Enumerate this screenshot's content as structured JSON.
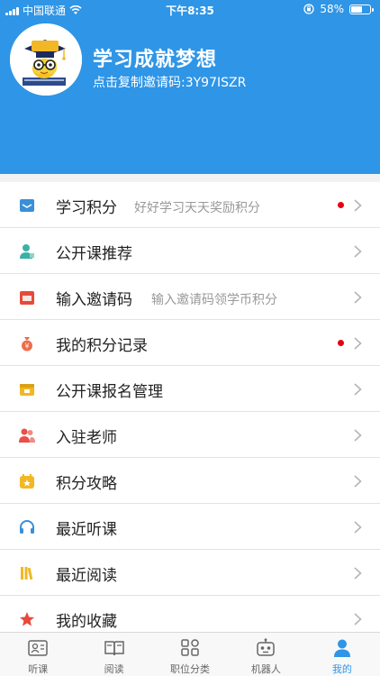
{
  "status_bar": {
    "carrier": "中国联通",
    "time": "下午8:35",
    "battery": "58%",
    "battery_level": 0.58
  },
  "profile": {
    "title": "学习成就梦想",
    "invite_text": "点击复制邀请码:3Y97ISZR",
    "avatar_badge": "学霸"
  },
  "menu": [
    {
      "label": "学习积分",
      "sub": "好好学习天天奖励积分",
      "dot": true,
      "icon": "envelope-icon",
      "color": "#3a8fd8"
    },
    {
      "label": "公开课推荐",
      "sub": "",
      "dot": false,
      "icon": "user-teacher-icon",
      "color": "#3bb1a8"
    },
    {
      "label": "输入邀请码",
      "sub": "输入邀请码领学币积分",
      "dot": false,
      "icon": "calendar-icon",
      "color": "#e64a3b"
    },
    {
      "label": "我的积分记录",
      "sub": "",
      "dot": true,
      "icon": "money-bag-icon",
      "color": "#ef6b4a"
    },
    {
      "label": "公开课报名管理",
      "sub": "",
      "dot": false,
      "icon": "signup-box-icon",
      "color": "#f2b724"
    },
    {
      "label": "入驻老师",
      "sub": "",
      "dot": false,
      "icon": "users-icon",
      "color": "#e8504a"
    },
    {
      "label": "积分攻略",
      "sub": "",
      "dot": false,
      "icon": "star-box-icon",
      "color": "#f2b724"
    },
    {
      "label": "最近听课",
      "sub": "",
      "dot": false,
      "icon": "headphones-icon",
      "color": "#3a8fd8"
    },
    {
      "label": "最近阅读",
      "sub": "",
      "dot": false,
      "icon": "books-icon",
      "color": "#f2b724"
    },
    {
      "label": "我的收藏",
      "sub": "",
      "dot": false,
      "icon": "star-icon",
      "color": "#e64a3b"
    }
  ],
  "tabs": [
    {
      "label": "听课",
      "icon": "id-card-icon",
      "active": false
    },
    {
      "label": "阅读",
      "icon": "open-book-icon",
      "active": false
    },
    {
      "label": "职位分类",
      "icon": "grid-icon",
      "active": false
    },
    {
      "label": "机器人",
      "icon": "robot-icon",
      "active": false
    },
    {
      "label": "我的",
      "icon": "person-icon",
      "active": true
    }
  ],
  "colors": {
    "primary": "#2f95e6",
    "dot": "#e60012"
  }
}
